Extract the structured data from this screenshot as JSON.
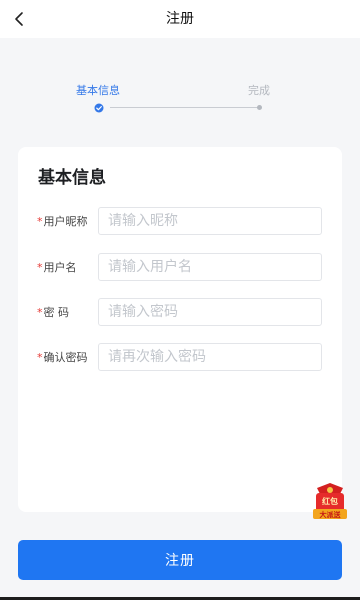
{
  "header": {
    "title": "注册",
    "back_icon": "chevron-left-icon"
  },
  "steps": {
    "items": [
      {
        "label": "基本信息",
        "state": "active"
      },
      {
        "label": "完成",
        "state": "pending"
      }
    ],
    "active_color": "#3478e8",
    "pending_color": "#b4b8bf"
  },
  "form": {
    "title": "基本信息",
    "required_mark": "*",
    "fields": [
      {
        "label": "用户昵称",
        "placeholder": "请输入昵称",
        "value": ""
      },
      {
        "label": "用户名",
        "placeholder": "请输入用户名",
        "value": ""
      },
      {
        "label": "密 码",
        "placeholder": "请输入密码",
        "value": ""
      },
      {
        "label": "确认密码",
        "placeholder": "请再次输入密码",
        "value": ""
      }
    ]
  },
  "promo": {
    "line1": "红包",
    "line2": "大派送",
    "icon": "red-envelope-icon"
  },
  "submit": {
    "label": "注册",
    "color": "#1f76f2"
  }
}
